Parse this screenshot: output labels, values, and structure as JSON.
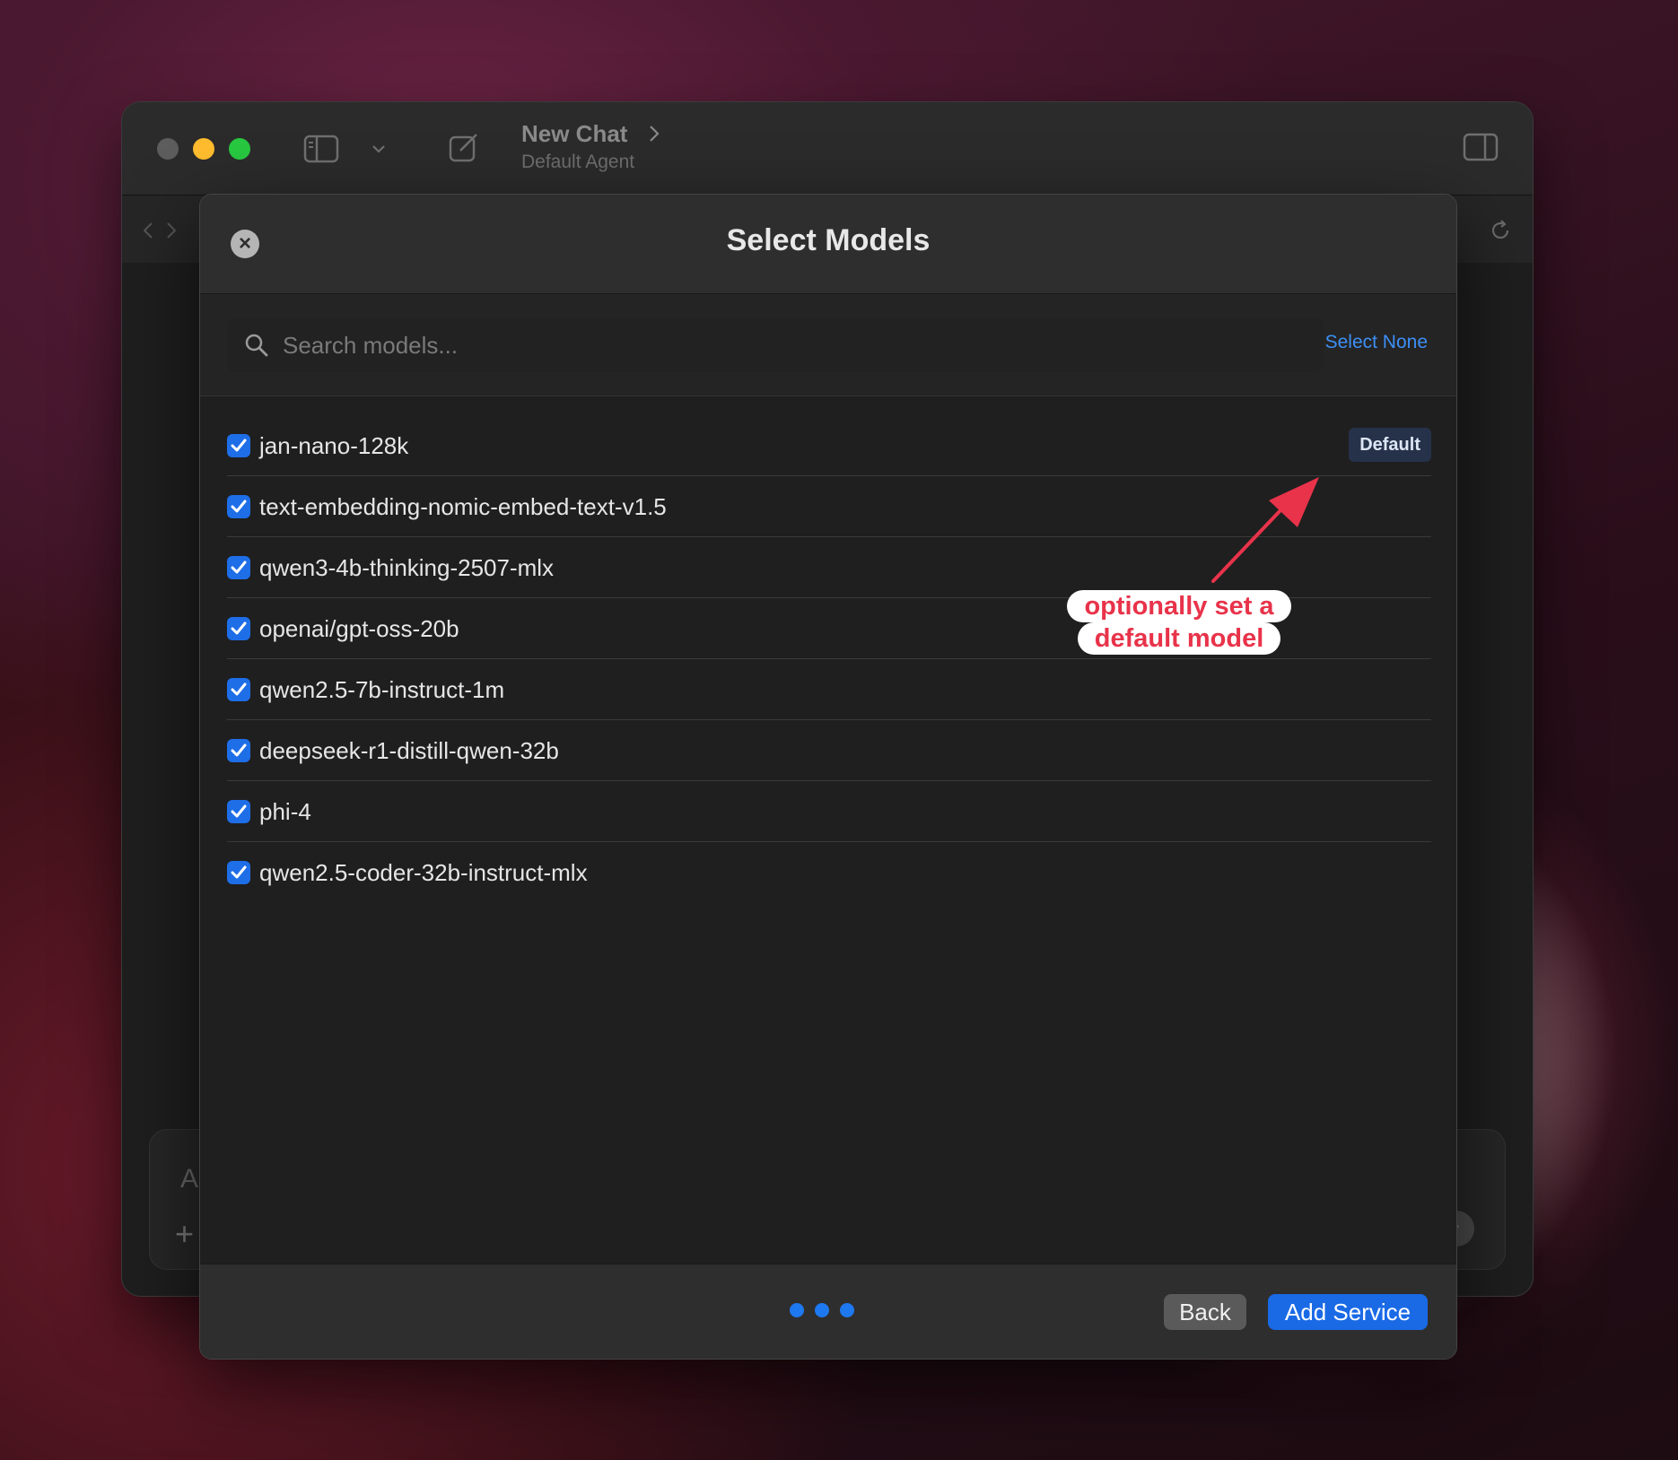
{
  "window": {
    "title": "New Chat",
    "subtitle": "Default Agent",
    "input_placeholder": "A"
  },
  "icons": {
    "sidebar_toggle": "sidebar-icon",
    "dropdown": "chevron-down-icon",
    "compose": "compose-icon",
    "title_chevron": "chevron-right-icon",
    "inspector_toggle": "right-panel-icon",
    "nav_back": "chevron-left-icon",
    "nav_forward": "chevron-right-icon",
    "reload": "reload-icon",
    "search": "search-icon",
    "close": "close-icon",
    "check": "checkmark-icon",
    "add": "plus-icon",
    "send": "arrow-up-icon"
  },
  "modal": {
    "title": "Select Models",
    "close_symbol": "×",
    "search_placeholder": "Search models...",
    "select_none_label": "Select None",
    "default_badge": "Default",
    "models": [
      {
        "name": "jan-nano-128k",
        "checked": true,
        "default": true
      },
      {
        "name": "text-embedding-nomic-embed-text-v1.5",
        "checked": true,
        "default": false
      },
      {
        "name": "qwen3-4b-thinking-2507-mlx",
        "checked": true,
        "default": false
      },
      {
        "name": "openai/gpt-oss-20b",
        "checked": true,
        "default": false
      },
      {
        "name": "qwen2.5-7b-instruct-1m",
        "checked": true,
        "default": false
      },
      {
        "name": "deepseek-r1-distill-qwen-32b",
        "checked": true,
        "default": false
      },
      {
        "name": "phi-4",
        "checked": true,
        "default": false
      },
      {
        "name": "qwen2.5-coder-32b-instruct-mlx",
        "checked": true,
        "default": false
      }
    ],
    "steps_total": 3,
    "back_label": "Back",
    "add_service_label": "Add Service"
  },
  "annotation": {
    "line1": "optionally set a",
    "line2": "default model"
  },
  "colors": {
    "accent": "#1e6ee8",
    "link": "#3d8ff5",
    "annotation": "#e8334a"
  }
}
